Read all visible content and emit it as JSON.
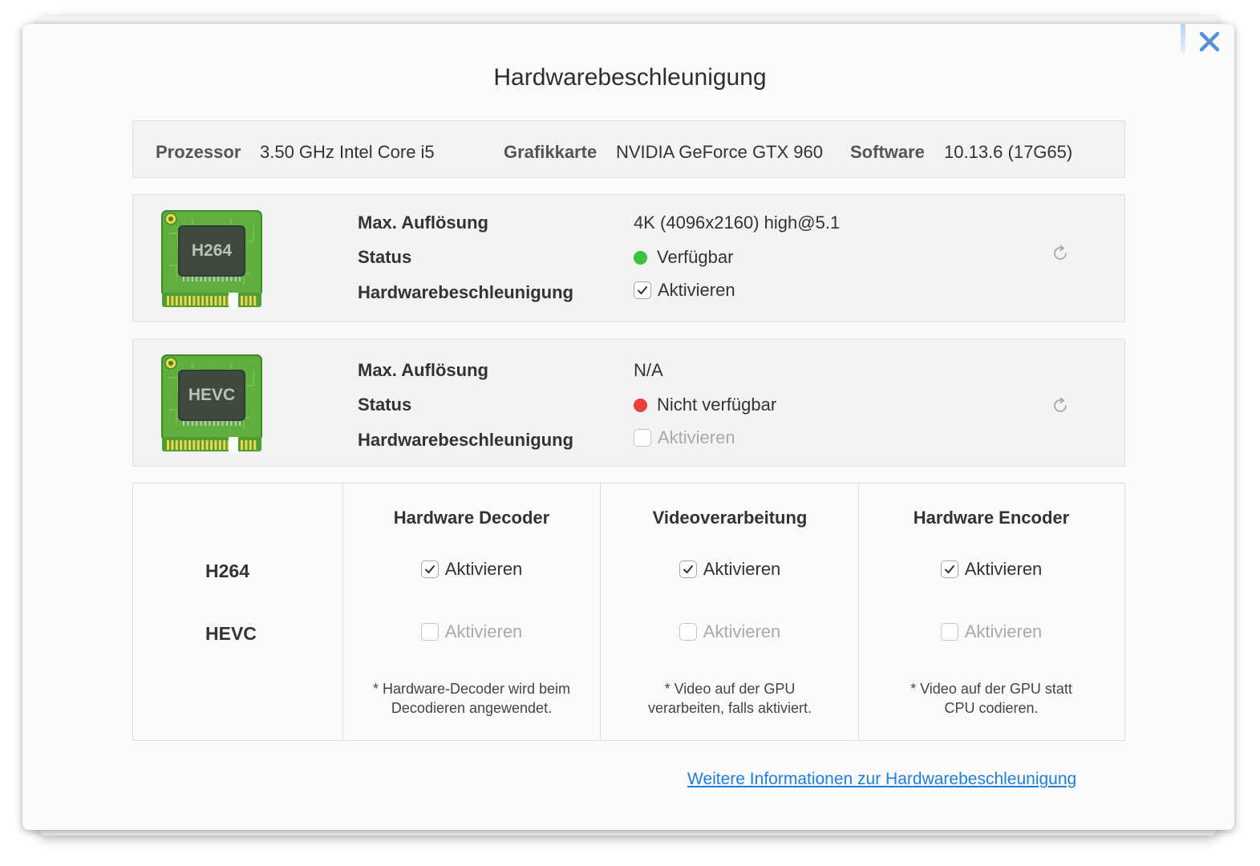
{
  "dialog": {
    "title": "Hardwarebeschleunigung",
    "close_icon": "close-x-icon"
  },
  "system": {
    "processor_label": "Prozessor",
    "processor_value": "3.50 GHz Intel Core i5",
    "gpu_label": "Grafikkarte",
    "gpu_value": "NVIDIA GeForce GTX 960",
    "software_label": "Software",
    "software_value": "10.13.6 (17G65)"
  },
  "codecs": [
    {
      "chip_label": "H264",
      "resolution_label": "Max. Auflösung",
      "resolution_value": "4K (4096x2160) high@5.1",
      "status_label": "Status",
      "status_value": "Verfügbar",
      "status_color": "#3cc13b",
      "accel_label": "Hardwarebeschleunigung",
      "accel_checkbox_label": "Aktivieren",
      "accel_checked": true,
      "accel_enabled": true
    },
    {
      "chip_label": "HEVC",
      "resolution_label": "Max. Auflösung",
      "resolution_value": "N/A",
      "status_label": "Status",
      "status_value": "Nicht verfügbar",
      "status_color": "#e8403a",
      "accel_label": "Hardwarebeschleunigung",
      "accel_checkbox_label": "Aktivieren",
      "accel_checked": false,
      "accel_enabled": false
    }
  ],
  "matrix": {
    "columns": [
      "Hardware Decoder",
      "Videoverarbeitung",
      "Hardware Encoder"
    ],
    "rows": [
      {
        "name": "H264",
        "cells": [
          {
            "label": "Aktivieren",
            "checked": true,
            "enabled": true
          },
          {
            "label": "Aktivieren",
            "checked": true,
            "enabled": true
          },
          {
            "label": "Aktivieren",
            "checked": true,
            "enabled": true
          }
        ]
      },
      {
        "name": "HEVC",
        "cells": [
          {
            "label": "Aktivieren",
            "checked": false,
            "enabled": false
          },
          {
            "label": "Aktivieren",
            "checked": false,
            "enabled": false
          },
          {
            "label": "Aktivieren",
            "checked": false,
            "enabled": false
          }
        ]
      }
    ],
    "notes": [
      {
        "line1": "* Hardware-Decoder wird beim",
        "line2": "Decodieren angewendet."
      },
      {
        "line1": "* Video auf der GPU",
        "line2": "verarbeiten, falls aktiviert."
      },
      {
        "line1": "* Video auf der GPU statt",
        "line2": "CPU codieren."
      }
    ]
  },
  "footer": {
    "link_text": "Weitere Informationen zur Hardwarebeschleunigung",
    "link_color": "#1c7ee0"
  }
}
